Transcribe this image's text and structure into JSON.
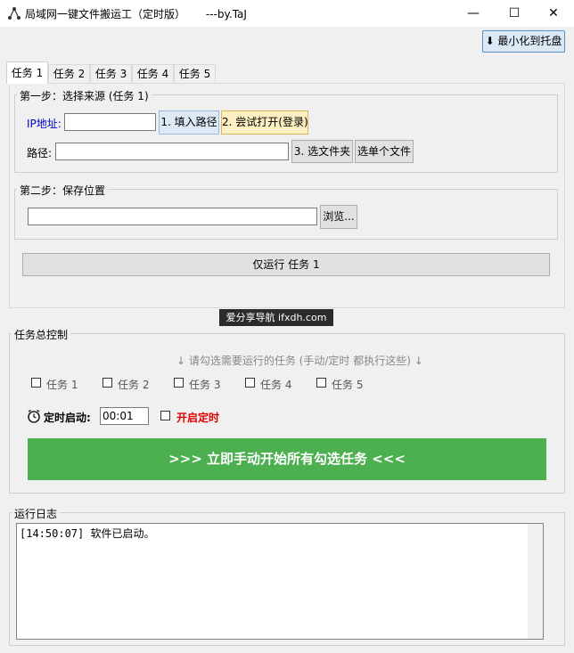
{
  "window": {
    "title": "局域网一键文件搬运工（定时版）      ---by.TaJ",
    "min_glyph": "—",
    "max_glyph": "☐",
    "close_glyph": "✕"
  },
  "toolbar": {
    "tray_button": "⬇ 最小化到托盘"
  },
  "tabs": [
    "任务 1",
    "任务 2",
    "任务 3",
    "任务 4",
    "任务 5"
  ],
  "step1": {
    "legend": "第一步：选择来源 (任务 1)",
    "ip_label": "IP地址:",
    "ip_value": "",
    "fill_path_button": "1. 填入路径",
    "try_open_button": "2. 尝试打开(登录)",
    "path_label": "路径:",
    "path_value": "",
    "select_folder_button": "3. 选文件夹",
    "select_file_button": "选单个文件"
  },
  "step2": {
    "legend": "第二步：保存位置",
    "save_value": "",
    "browse_button": "浏览..."
  },
  "run_task_button": "仅运行 任务 1",
  "watermark": "爱分享导航 ifxdh.com",
  "control": {
    "legend": "任务总控制",
    "hint": "↓ 请勾选需要运行的任务 (手动/定时 都执行这些) ↓",
    "tasks": [
      "任务 1",
      "任务 2",
      "任务 3",
      "任务 4",
      "任务 5"
    ],
    "timer_label": "定时启动:",
    "timer_value": "00:01",
    "enable_timer_label": "开启定时",
    "start_all_button": ">>> 立即手动开始所有勾选任务 <<<",
    "colors": {
      "start_button": "#4caf50",
      "enable_timer": "#e00000",
      "hint": "#888888",
      "ip_label": "#0000cc"
    }
  },
  "log": {
    "legend": "运行日志",
    "lines": [
      "[14:50:07] 软件已启动。"
    ]
  }
}
